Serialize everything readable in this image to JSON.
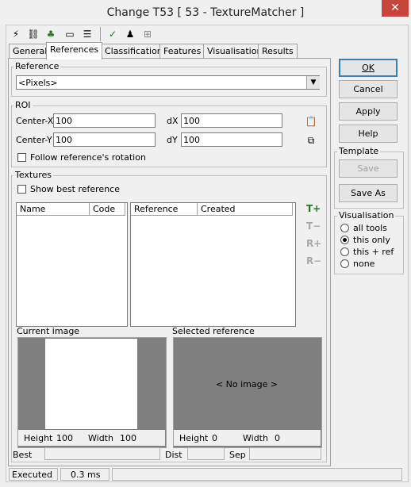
{
  "window": {
    "title": "Change T53 [ 53 - TextureMatcher ]",
    "close_symbol": "✕"
  },
  "toolbar": {
    "icons": [
      "lightning-icon",
      "link-icon",
      "plugin-icon",
      "console-icon",
      "list-icon",
      "check-icon",
      "person-icon",
      "grid-icon"
    ]
  },
  "tabs": [
    "General",
    "References",
    "Classification",
    "Features",
    "Visualisation",
    "Results"
  ],
  "active_tab": "References",
  "reference": {
    "legend": "Reference",
    "selected": "<Pixels>"
  },
  "roi": {
    "legend": "ROI",
    "center_x_label": "Center-X",
    "center_x_value": "100",
    "center_y_label": "Center-Y",
    "center_y_value": "100",
    "dx_label": "dX",
    "dx_value": "100",
    "dy_label": "dY",
    "dy_value": "100",
    "follow_rotation_label": "Follow reference's rotation"
  },
  "textures": {
    "legend": "Textures",
    "show_best_label": "Show best reference",
    "left_columns": [
      "Name",
      "Code"
    ],
    "right_columns": [
      "Reference",
      "Created"
    ],
    "side_buttons": [
      "T+",
      "T−",
      "R+",
      "R−"
    ],
    "current_image_label": "Current image",
    "selected_reference_label": "Selected reference",
    "no_image_text": "< No image >",
    "current_height_label": "Height",
    "current_height_value": "100",
    "current_width_label": "Width",
    "current_width_value": "100",
    "selected_height_label": "Height",
    "selected_height_value": "0",
    "selected_width_label": "Width",
    "selected_width_value": "0",
    "best_label": "Best",
    "dist_label": "Dist",
    "sep_label": "Sep"
  },
  "buttons": {
    "ok": "OK",
    "cancel": "Cancel",
    "apply": "Apply",
    "help": "Help"
  },
  "template": {
    "legend": "Template",
    "save": "Save",
    "save_as": "Save As"
  },
  "visualisation": {
    "legend": "Visualisation",
    "options": [
      "all tools",
      "this only",
      "this + ref",
      "none"
    ],
    "selected": "this only"
  },
  "status": {
    "state": "Executed",
    "time": "0.3 ms"
  },
  "colors": {
    "accent_green": "#1a7a1a",
    "close_red": "#c7463c"
  }
}
